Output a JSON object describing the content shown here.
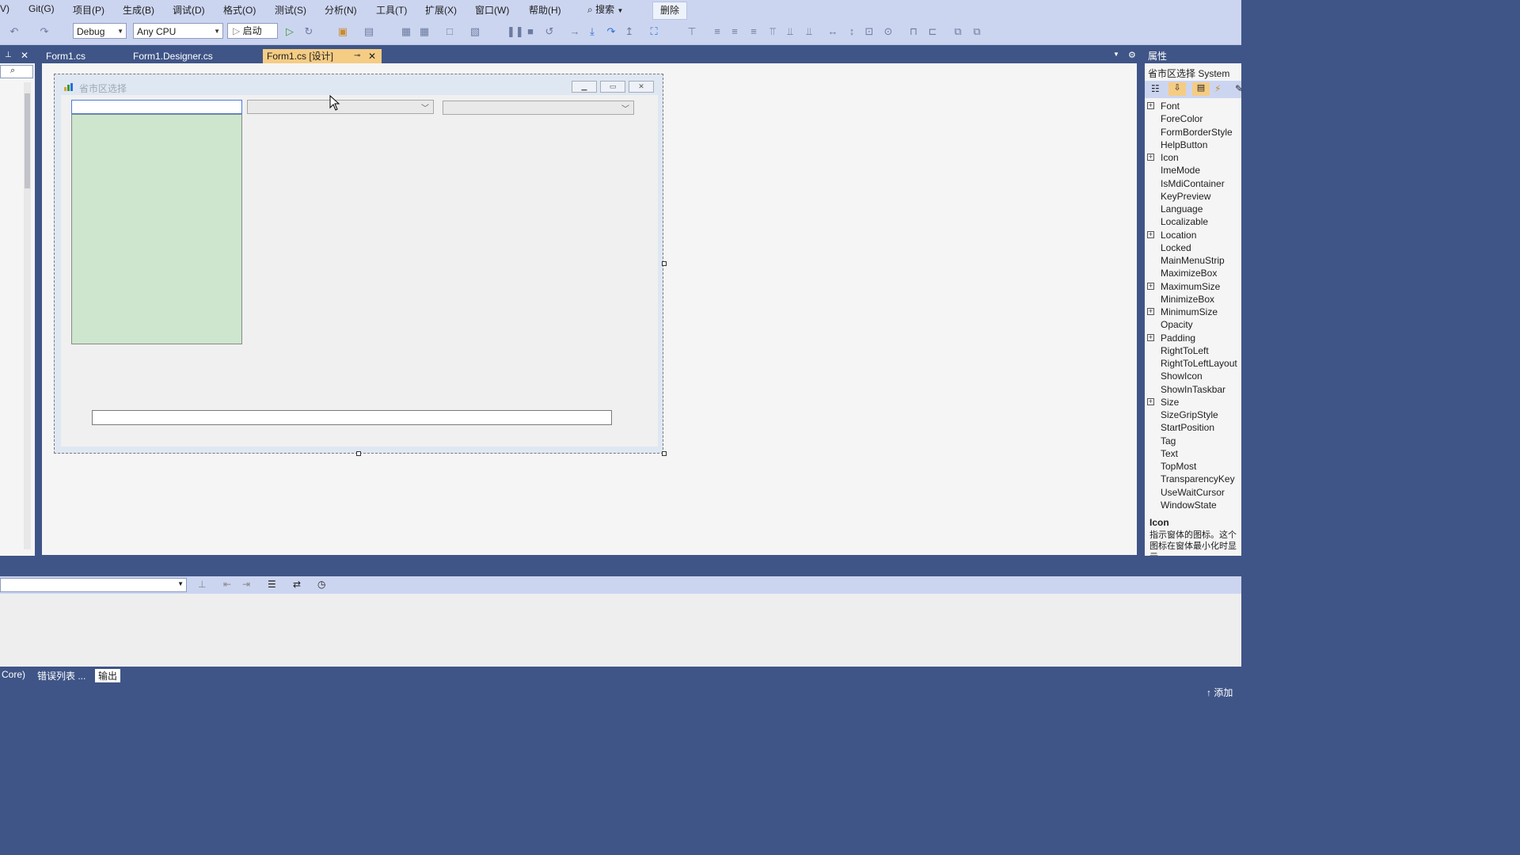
{
  "menu": {
    "items": [
      "V)",
      "Git(G)",
      "项目(P)",
      "生成(B)",
      "调试(D)",
      "格式(O)",
      "测试(S)",
      "分析(N)",
      "工具(T)",
      "扩展(X)",
      "窗口(W)",
      "帮助(H)"
    ],
    "search_label": "搜索",
    "delete_label": "删除"
  },
  "toolbar": {
    "config": "Debug",
    "platform": "Any CPU",
    "start_label": "启动"
  },
  "tabs": [
    "Form1.cs",
    "Form1.Designer.cs",
    "Form1.cs [设计]"
  ],
  "form": {
    "title": "省市区选择"
  },
  "properties": {
    "header": "属性",
    "object": "省市区选择  System",
    "rows": [
      {
        "name": "Font",
        "expandable": true
      },
      {
        "name": "ForeColor",
        "expandable": false
      },
      {
        "name": "FormBorderStyle",
        "expandable": false
      },
      {
        "name": "HelpButton",
        "expandable": false
      },
      {
        "name": "Icon",
        "expandable": true
      },
      {
        "name": "ImeMode",
        "expandable": false
      },
      {
        "name": "IsMdiContainer",
        "expandable": false
      },
      {
        "name": "KeyPreview",
        "expandable": false
      },
      {
        "name": "Language",
        "expandable": false
      },
      {
        "name": "Localizable",
        "expandable": false
      },
      {
        "name": "Location",
        "expandable": true
      },
      {
        "name": "Locked",
        "expandable": false
      },
      {
        "name": "MainMenuStrip",
        "expandable": false
      },
      {
        "name": "MaximizeBox",
        "expandable": false
      },
      {
        "name": "MaximumSize",
        "expandable": true
      },
      {
        "name": "MinimizeBox",
        "expandable": false
      },
      {
        "name": "MinimumSize",
        "expandable": true
      },
      {
        "name": "Opacity",
        "expandable": false
      },
      {
        "name": "Padding",
        "expandable": true
      },
      {
        "name": "RightToLeft",
        "expandable": false
      },
      {
        "name": "RightToLeftLayout",
        "expandable": false
      },
      {
        "name": "ShowIcon",
        "expandable": false
      },
      {
        "name": "ShowInTaskbar",
        "expandable": false
      },
      {
        "name": "Size",
        "expandable": true
      },
      {
        "name": "SizeGripStyle",
        "expandable": false
      },
      {
        "name": "StartPosition",
        "expandable": false
      },
      {
        "name": "Tag",
        "expandable": false
      },
      {
        "name": "Text",
        "expandable": false
      },
      {
        "name": "TopMost",
        "expandable": false
      },
      {
        "name": "TransparencyKey",
        "expandable": false
      },
      {
        "name": "UseWaitCursor",
        "expandable": false
      },
      {
        "name": "WindowState",
        "expandable": false
      }
    ],
    "desc_title": "Icon",
    "desc_text": "指示窗体的图标。这个图标在窗体最小化时显示。"
  },
  "bottom_tabs": [
    "Core)",
    "错误列表 ...",
    "输出"
  ],
  "status": {
    "add_label": "↑ 添加"
  }
}
